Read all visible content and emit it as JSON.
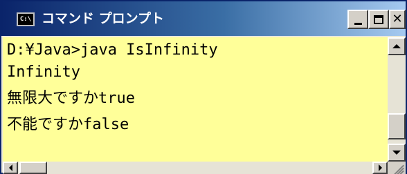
{
  "window": {
    "title": "コマンド プロンプト",
    "icon": "console-app-icon",
    "icon_text": "C:\\"
  },
  "console": {
    "background": "#ffff99",
    "lines": [
      "D:¥Java>java IsInfinity",
      "Infinity",
      "無限大ですかtrue",
      "不能ですかfalse"
    ]
  },
  "colors": {
    "titlebar_start": "#0a246a",
    "titlebar_end": "#a6caf0",
    "frame": "#d4d0c8"
  }
}
